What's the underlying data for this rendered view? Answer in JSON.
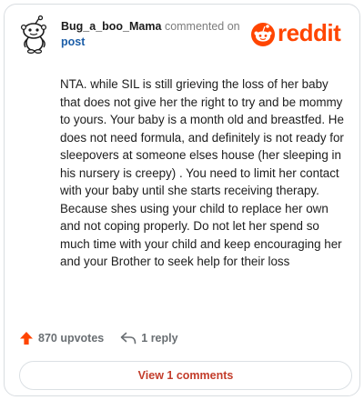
{
  "comment": {
    "username": "Bug_a_boo_Mama",
    "commented_on": "commented on",
    "post_label": "post",
    "body": "NTA. while SIL is still grieving the loss of her baby that does not give her the right to try and be mommy to yours. Your baby is a month old and breastfed. He does not need formula, and definitely is not ready for sleepovers at someone elses house (her sleeping in his nursery is creepy) . You need to limit her contact with your baby until she starts receiving therapy. Because shes using your child to replace her own and not coping properly. Do not let her spend so much time with your child and keep encouraging her and your Brother to seek help for their loss"
  },
  "brand": {
    "name": "reddit",
    "color": "#ff4500"
  },
  "actions": {
    "upvotes": "870 upvotes",
    "replies": "1 reply"
  },
  "footer": {
    "view_comments": "View 1 comments"
  },
  "icons": {
    "avatar": "snoo-avatar-icon",
    "logo": "reddit-logo-icon",
    "upvote": "upvote-arrow-icon",
    "reply": "reply-arrow-icon"
  }
}
